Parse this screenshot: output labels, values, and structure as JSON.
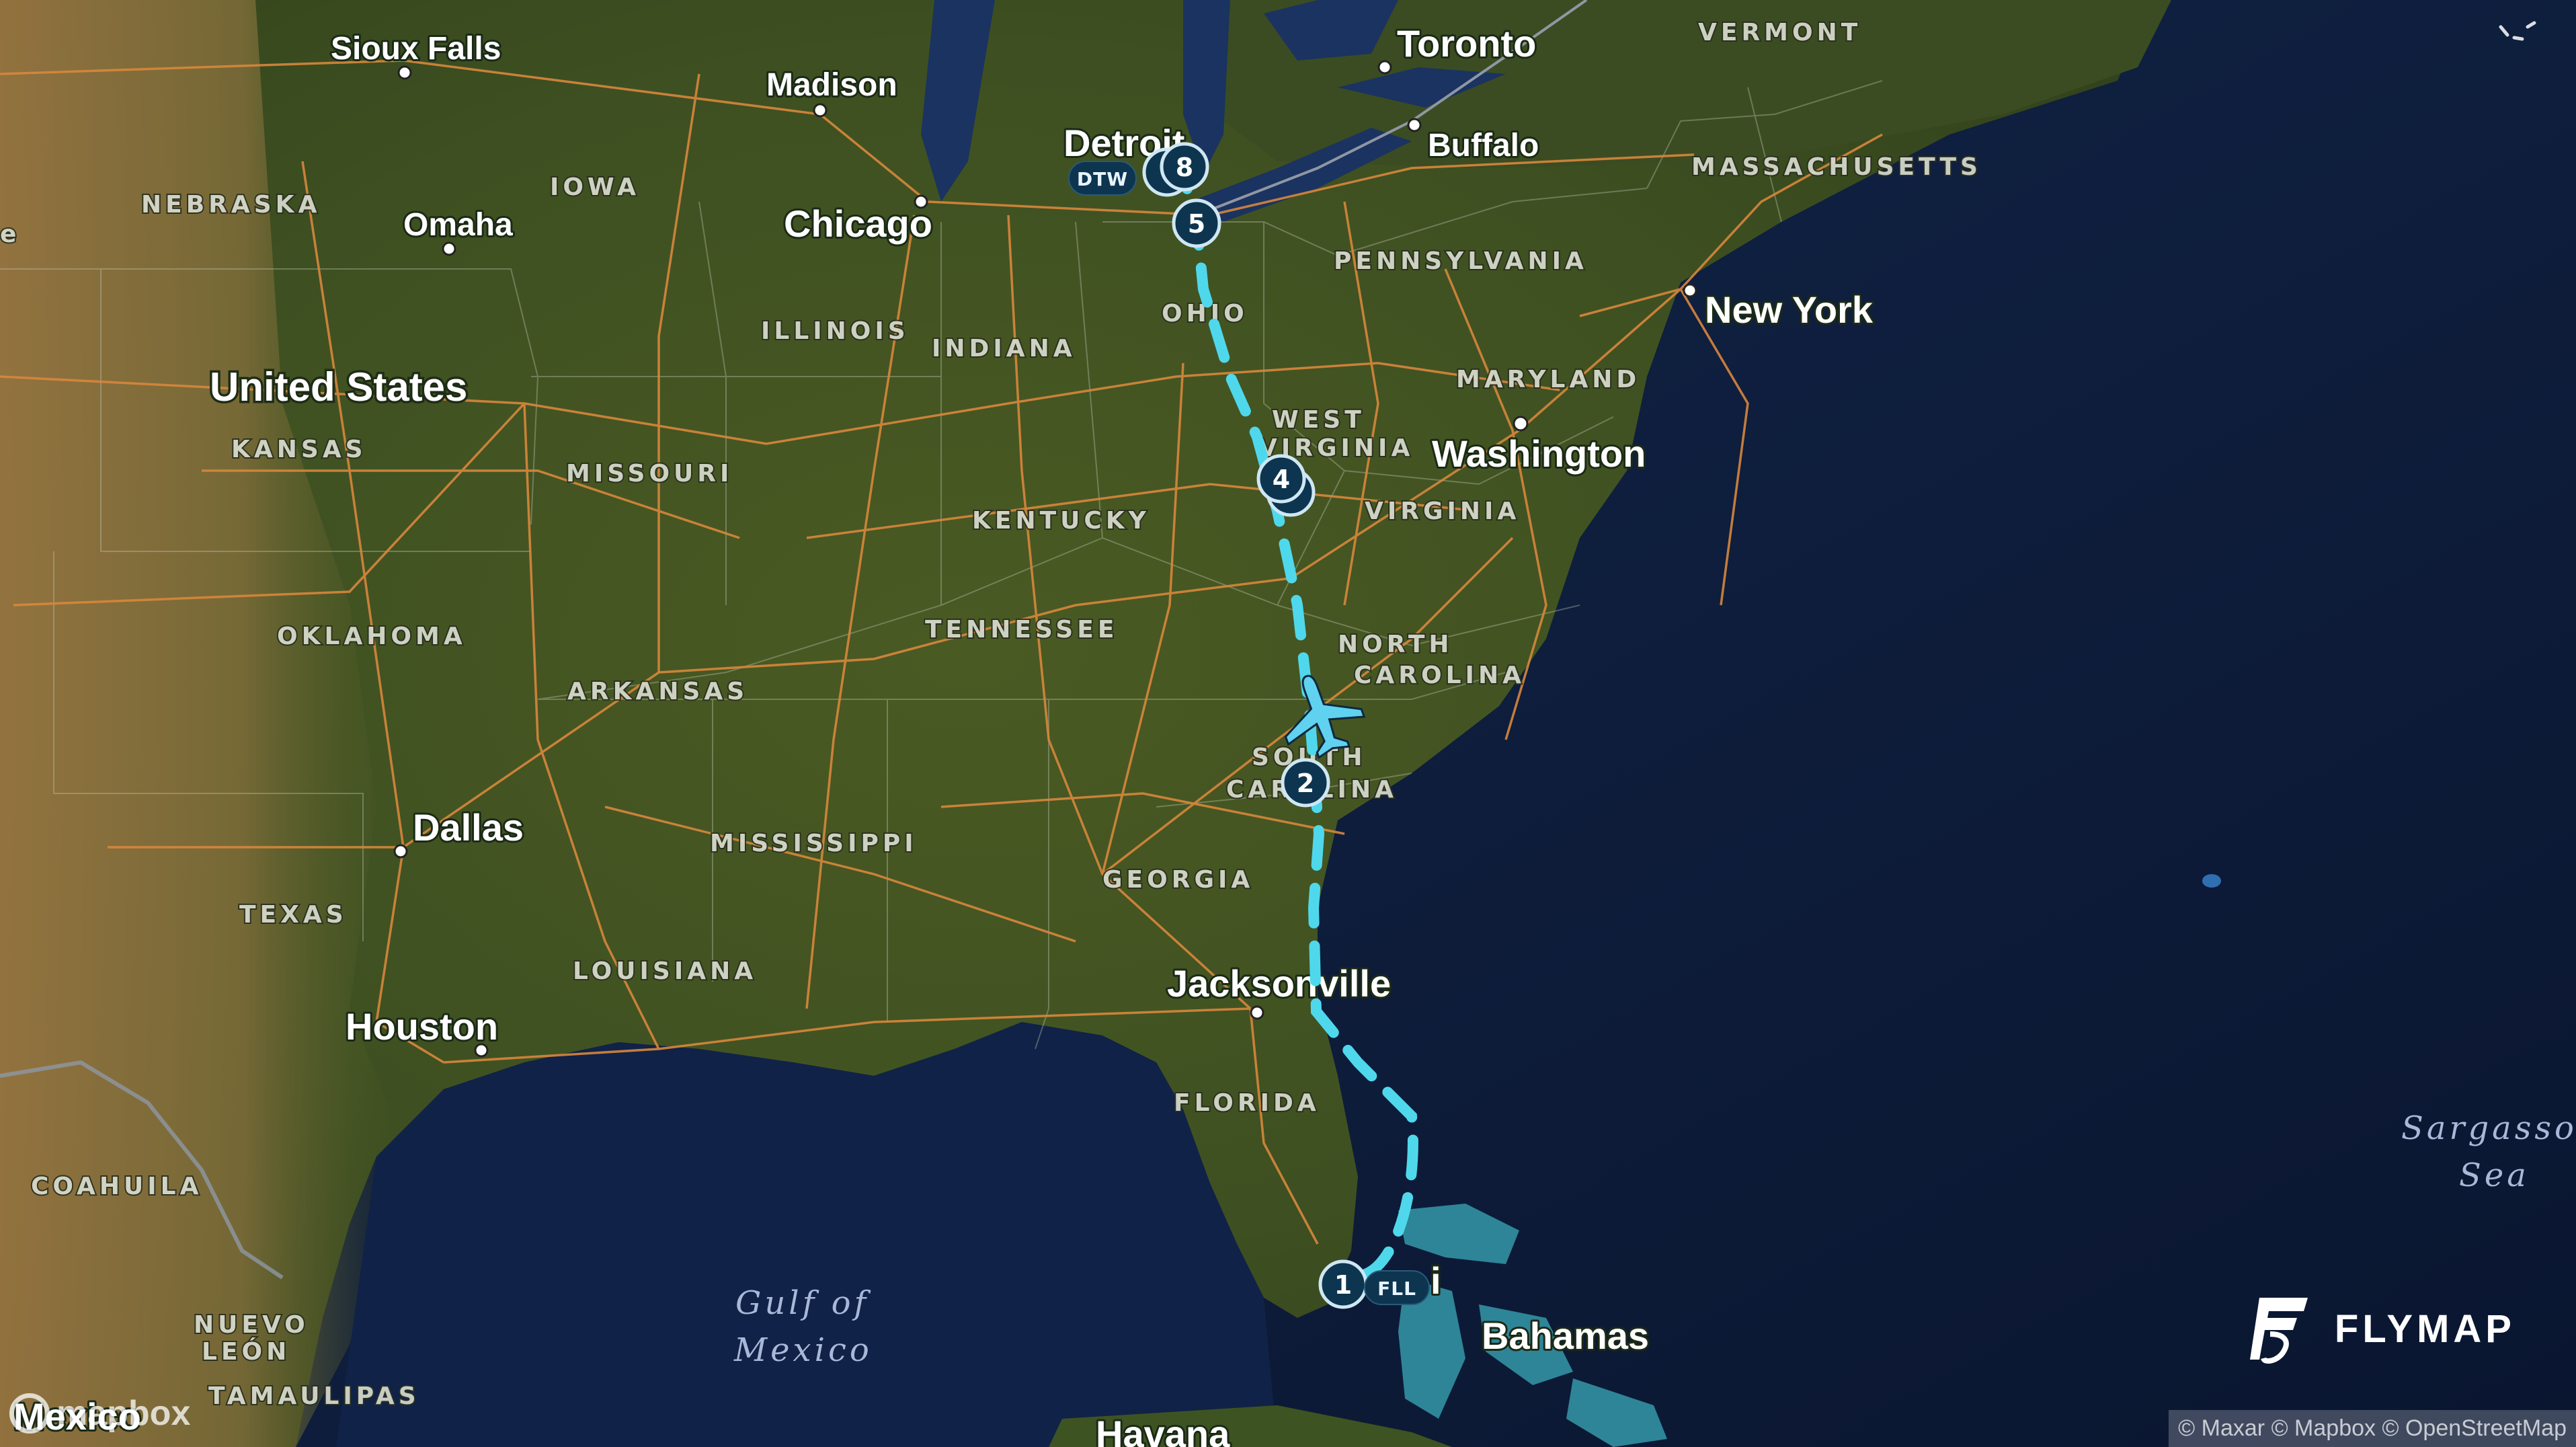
{
  "map": {
    "cities": [
      {
        "name": "Sioux Falls"
      },
      {
        "name": "Madison"
      },
      {
        "name": "Toronto"
      },
      {
        "name": "Detroit"
      },
      {
        "name": "Buffalo"
      },
      {
        "name": "Omaha"
      },
      {
        "name": "Chicago"
      },
      {
        "name": "New York"
      },
      {
        "name": "Washington"
      },
      {
        "name": "Dallas"
      },
      {
        "name": "Houston"
      },
      {
        "name": "Jacksonville"
      },
      {
        "name": "Bahamas"
      },
      {
        "name": "Havana"
      },
      {
        "name": "Mexico"
      },
      {
        "name": "i"
      }
    ],
    "country_label": "United States",
    "states": [
      "VERMONT",
      "MASSACHUSETTS",
      "NEBRASKA",
      "IOWA",
      "PENNSYLVANIA",
      "OHIO",
      "ILLINOIS",
      "INDIANA",
      "MARYLAND",
      "WEST",
      "VIRGINIA",
      "KANSAS",
      "MISSOURI",
      "VIRGINIA",
      "KENTUCKY",
      "NORTH",
      "CAROLINA",
      "OKLAHOMA",
      "TENNESSEE",
      "ARKANSAS",
      "SOUTH",
      "CAROLINA",
      "MISSISSIPPI",
      "GEORGIA",
      "TEXAS",
      "LOUISIANA",
      "FLORIDA",
      "COAHUILA",
      "NUEVO",
      "LEÓN",
      "TAMAULIPAS",
      "e"
    ],
    "water_labels": [
      "Gulf of",
      "Mexico",
      "Sargasso",
      "Sea"
    ]
  },
  "route": {
    "origin_code": "FLL",
    "destination_code": "DTW",
    "waypoints": [
      "1",
      "2",
      "4",
      "5",
      "8"
    ],
    "path_color": "#4fd8ec",
    "marker_color": "#0d3550",
    "aircraft_icon": "airplane-icon"
  },
  "brand": {
    "name": "FLYMAP",
    "logo_icon": "flymap-logo-icon"
  },
  "attribution": "© Maxar © Mapbox © OpenStreetMap",
  "mapbox_logo": "mapbox"
}
